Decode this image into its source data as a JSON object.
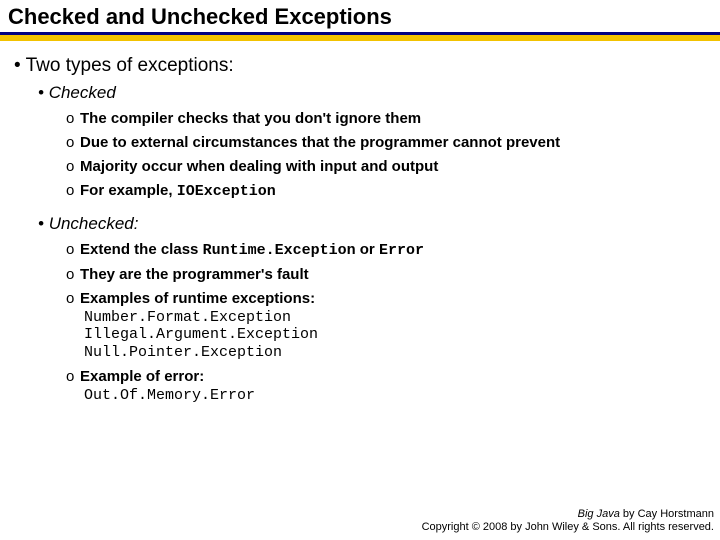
{
  "title": "Checked and Unchecked Exceptions",
  "lvl1": "Two types of exceptions:",
  "checked": {
    "heading": "Checked",
    "p1": "The compiler checks that you don't ignore them",
    "p2": "Due to external circumstances that the programmer cannot prevent",
    "p3": "Majority occur when dealing with input and output",
    "p4a": "For example, ",
    "p4b": "IOException"
  },
  "unchecked": {
    "heading": "Unchecked:",
    "p1a": "Extend the class ",
    "p1b": "Runtime.Exception",
    "p1c": " or ",
    "p1d": "Error",
    "p2": "They are the programmer's fault",
    "p3": "Examples of runtime exceptions:",
    "code1": "Number.Format.Exception",
    "code2": "Illegal.Argument.Exception",
    "code3": "Null.Pointer.Exception",
    "p4": "Example of error:",
    "code4": "Out.Of.Memory.Error"
  },
  "footer": {
    "book": "Big Java",
    "by": " by Cay Horstmann",
    "copy": "Copyright © 2008 by John Wiley & Sons. All rights reserved."
  },
  "bullets": {
    "dot": "•",
    "o": "o"
  }
}
